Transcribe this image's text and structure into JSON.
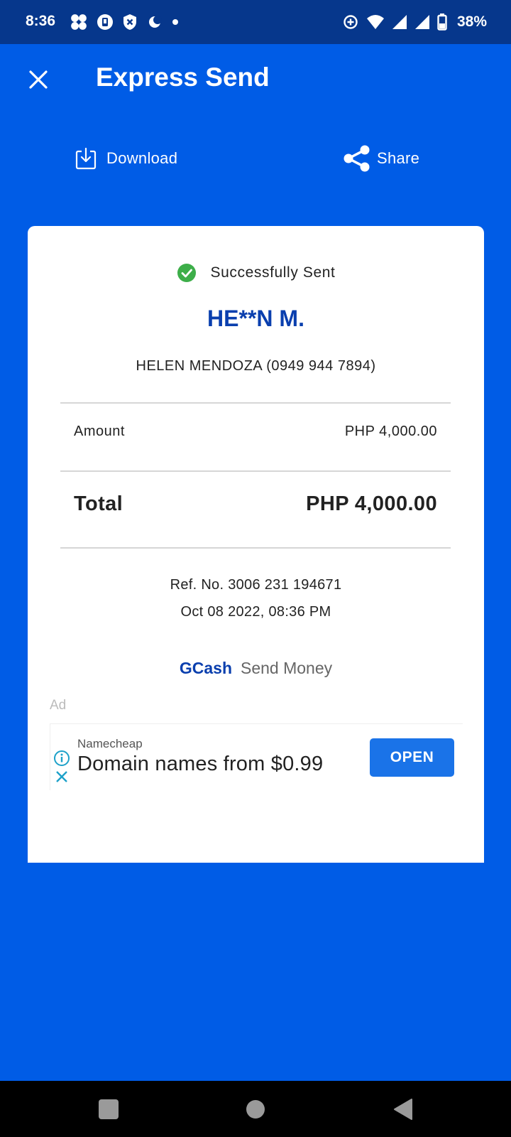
{
  "status_bar": {
    "time": "8:36",
    "battery": "38%"
  },
  "header": {
    "title": "Express Send"
  },
  "actions": {
    "download_label": "Download",
    "share_label": "Share"
  },
  "receipt": {
    "status": "Successfully Sent",
    "recipient_masked": "HE**N M.",
    "recipient_full": "HELEN MENDOZA (0949 944 7894)",
    "amount_label": "Amount",
    "amount_value": "PHP 4,000.00",
    "total_label": "Total",
    "total_value": "PHP 4,000.00",
    "ref_no": "Ref. No. 3006 231 194671",
    "date": "Oct 08 2022, 08:36 PM",
    "brand": "GCash",
    "service": "Send Money"
  },
  "ad": {
    "label": "Ad",
    "advertiser": "Namecheap",
    "headline": "Domain names from $0.99",
    "cta": "OPEN"
  },
  "colors": {
    "primary_blue": "#005CE6",
    "status_bar": "#06378C",
    "brand_blue": "#0A3FAE",
    "success_green": "#3DAE49",
    "ad_button": "#1A73E8"
  }
}
